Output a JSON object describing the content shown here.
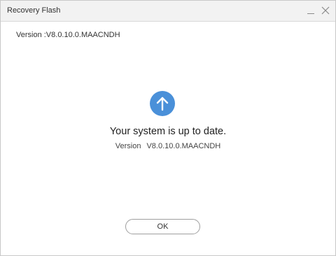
{
  "window": {
    "title": "Recovery Flash"
  },
  "content": {
    "version_label": "Version :V8.0.10.0.MAACNDH",
    "status_icon": "arrow-up-circle-icon",
    "status_message": "Your system is up to date.",
    "version_prefix": "Version",
    "version_value": "V8.0.10.0.MAACNDH"
  },
  "footer": {
    "ok_label": "OK"
  },
  "colors": {
    "accent": "#4a90d9",
    "titlebar": "#f2f2f2"
  }
}
